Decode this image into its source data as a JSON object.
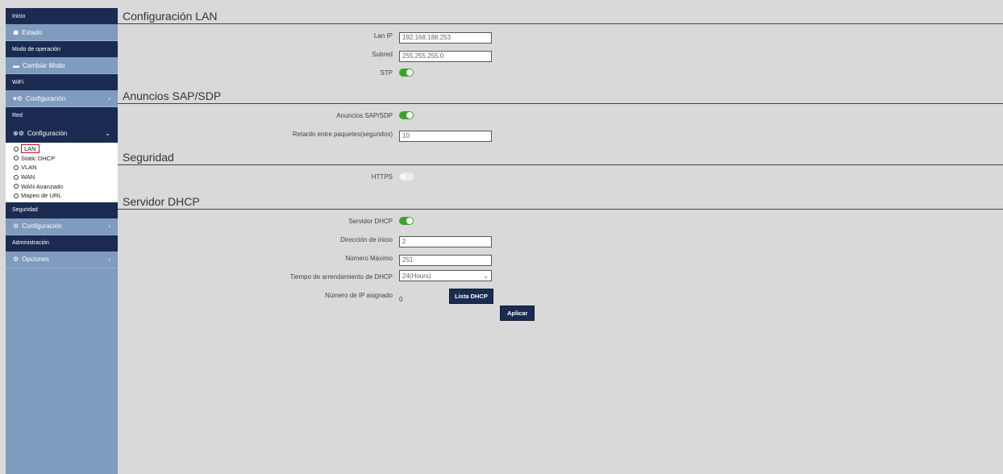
{
  "sidebar": {
    "home_header": "Inicio",
    "status_item": "Estado",
    "mode_header": "Modo de operación",
    "change_mode_item": "Cambiar Modo",
    "wifi_header": "WiFi",
    "wifi_config_item": "Configuración",
    "network_header": "Red",
    "network_config_item": "Configuración",
    "network_subitems": [
      "LAN",
      "Static DHCP",
      "VLAN",
      "WAN",
      "WAN Avanzado",
      "Mapeo de URL"
    ],
    "security_header": "Seguridad",
    "security_config_item": "Configuración",
    "admin_header": "Administración",
    "options_item": "Opciones"
  },
  "lan": {
    "title": "Configuración LAN",
    "lan_ip_label": "Lan IP",
    "lan_ip_value": "192.168.188.253",
    "subnet_label": "Subred",
    "subnet_value": "255.255.255.0",
    "stp_label": "STP",
    "stp_enabled": true
  },
  "sap": {
    "title": "Anuncios SAP/SDP",
    "announce_label": "Anuncios SAP/SDP",
    "announce_enabled": true,
    "delay_label": "Retardo entre paquetes(segundos)",
    "delay_value": "10"
  },
  "security": {
    "title": "Seguridad",
    "https_label": "HTTPS",
    "https_enabled": false
  },
  "dhcp": {
    "title": "Servidor DHCP",
    "server_label": "Servidor DHCP",
    "server_enabled": true,
    "start_label": "Dirección de inicio",
    "start_value": "2",
    "max_label": "Número Máximo",
    "max_value": "251",
    "lease_label": "Tiempo de arrendamiento de DHCP",
    "lease_value": "24(Hours)",
    "assigned_label": "Número de IP asignado",
    "assigned_value": "0",
    "list_button": "Lista DHCP",
    "apply_button": "Aplicar"
  },
  "colors": {
    "sidebar_dark": "#1b2b52",
    "sidebar_light": "#7f9bbe",
    "toggle_on": "#3aa32a",
    "selected_outline": "#c0141c"
  }
}
